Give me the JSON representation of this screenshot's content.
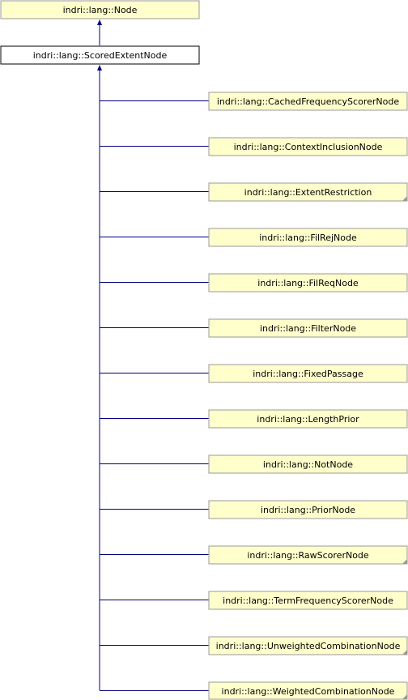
{
  "diagram": {
    "colors": {
      "node_fill": "#ffffcc",
      "node_border": "#999999",
      "focus_fill": "#ffffff",
      "focus_border": "#000000",
      "edge": "#000080"
    },
    "base": {
      "id": "node-base",
      "label": "indri::lang::Node"
    },
    "focus": {
      "id": "node-scored-extent",
      "label": "indri::lang::ScoredExtentNode"
    },
    "children": [
      {
        "id": "node-cached-frequency-scorer",
        "label": "indri::lang::CachedFrequencyScorerNode",
        "has_more": false
      },
      {
        "id": "node-context-inclusion",
        "label": "indri::lang::ContextInclusionNode",
        "has_more": false
      },
      {
        "id": "node-extent-restriction",
        "label": "indri::lang::ExtentRestriction",
        "has_more": true
      },
      {
        "id": "node-fil-rej",
        "label": "indri::lang::FilRejNode",
        "has_more": false
      },
      {
        "id": "node-fil-req",
        "label": "indri::lang::FilReqNode",
        "has_more": false
      },
      {
        "id": "node-filter",
        "label": "indri::lang::FilterNode",
        "has_more": false
      },
      {
        "id": "node-fixed-passage",
        "label": "indri::lang::FixedPassage",
        "has_more": false
      },
      {
        "id": "node-length-prior",
        "label": "indri::lang::LengthPrior",
        "has_more": false
      },
      {
        "id": "node-not",
        "label": "indri::lang::NotNode",
        "has_more": false
      },
      {
        "id": "node-prior",
        "label": "indri::lang::PriorNode",
        "has_more": false
      },
      {
        "id": "node-raw-scorer",
        "label": "indri::lang::RawScorerNode",
        "has_more": true
      },
      {
        "id": "node-term-frequency-scorer",
        "label": "indri::lang::TermFrequencyScorerNode",
        "has_more": false
      },
      {
        "id": "node-unweighted-combination",
        "label": "indri::lang::UnweightedCombinationNode",
        "has_more": true
      },
      {
        "id": "node-weighted-combination",
        "label": "indri::lang::WeightedCombinationNode",
        "has_more": true
      }
    ]
  }
}
